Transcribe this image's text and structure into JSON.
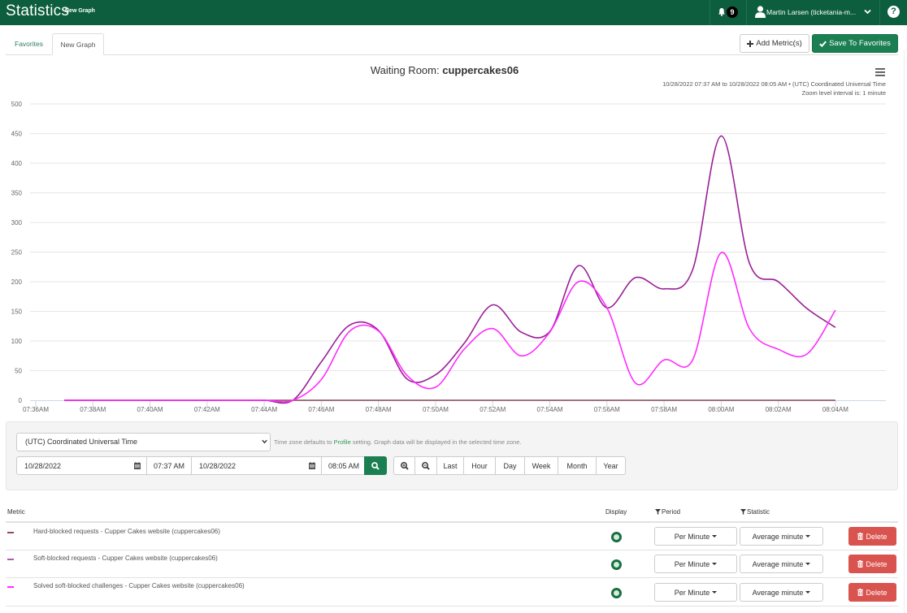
{
  "header": {
    "app_title": "Statistics",
    "subtitle": "New Graph",
    "notifications_count": "9",
    "user_name": "Martin Larsen (ticketania-m...",
    "help_label": "?"
  },
  "tabs": [
    {
      "label": "Favorites",
      "active": false
    },
    {
      "label": "New Graph",
      "active": true
    }
  ],
  "toolbar": {
    "add_metric_label": "Add Metric(s)",
    "save_favorites_label": "Save To Favorites"
  },
  "chart_data": {
    "type": "line",
    "smoothing": "spline",
    "title": "Waiting Room: cuppercakes06",
    "title_prefix": "Waiting Room: ",
    "title_name": "cuppercakes06",
    "subtitle_line1": "10/28/2022 07:37 AM to 10/28/2022 08:05 AM • (UTC) Coordinated Universal Time",
    "subtitle_line2": "Zoom level interval is: 1 minute",
    "xlabel": "",
    "ylabel": "",
    "grid": true,
    "legend": "none (shown in metric table below)",
    "ylim": [
      0,
      500
    ],
    "y_ticks": [
      0,
      50,
      100,
      150,
      200,
      250,
      300,
      350,
      400,
      450,
      500
    ],
    "x_tick_labels": [
      "07:36AM",
      "07:38AM",
      "07:40AM",
      "07:42AM",
      "07:44AM",
      "07:46AM",
      "07:48AM",
      "07:50AM",
      "07:52AM",
      "07:54AM",
      "07:56AM",
      "07:58AM",
      "08:00AM",
      "08:02AM",
      "08:04AM"
    ],
    "x": [
      "07:37",
      "07:38",
      "07:39",
      "07:40",
      "07:41",
      "07:42",
      "07:43",
      "07:44",
      "07:45",
      "07:46",
      "07:47",
      "07:48",
      "07:49",
      "07:50",
      "07:51",
      "07:52",
      "07:53",
      "07:54",
      "07:55",
      "07:56",
      "07:57",
      "07:58",
      "07:59",
      "08:00",
      "08:01",
      "08:02",
      "08:03",
      "08:04"
    ],
    "series": [
      {
        "name": "Hard-blocked requests - Cupper Cakes website (cuppercakes06)",
        "color": "#8e4a58",
        "values": [
          0,
          0,
          0,
          0,
          0,
          0,
          0,
          0,
          0,
          0,
          0,
          0,
          0,
          0,
          0,
          0,
          0,
          0,
          0,
          0,
          0,
          0,
          0,
          0,
          0,
          0,
          0,
          0
        ]
      },
      {
        "name": "Soft-blocked requests - Cupper Cakes website (cuppercakes06)",
        "color": "#991f96",
        "values": [
          0,
          0,
          0,
          0,
          0,
          0,
          0,
          0,
          0,
          65,
          127,
          118,
          36,
          43,
          96,
          161,
          115,
          116,
          227,
          156,
          207,
          188,
          220,
          446,
          230,
          200,
          155,
          123
        ]
      },
      {
        "name": "Solved soft-blocked challenges - Cupper Cakes website (cuppercakes06)",
        "color": "#ff2bff",
        "values": [
          0,
          0,
          0,
          0,
          0,
          0,
          0,
          0,
          0,
          35,
          117,
          117,
          42,
          22,
          86,
          121,
          75,
          115,
          200,
          156,
          29,
          68,
          68,
          249,
          120,
          86,
          78,
          152
        ]
      }
    ]
  },
  "controls": {
    "timezone": "(UTC) Coordinated Universal Time",
    "timezone_note_prefix": "Time zone defaults to ",
    "timezone_note_link": "Profile",
    "timezone_note_suffix": " setting. Graph data will be displayed in the selected time zone.",
    "start_date": "10/28/2022",
    "start_time": "07:37 AM",
    "end_date": "10/28/2022",
    "end_time": "08:05 AM",
    "range_buttons": [
      "Last",
      "Hour",
      "Day",
      "Week",
      "Month",
      "Year"
    ]
  },
  "metrics_table": {
    "headers": {
      "metric": "Metric",
      "display": "Display",
      "period": "Period",
      "statistic": "Statistic"
    },
    "rows": [
      {
        "name": "Hard-blocked requests - Cupper Cakes website (cuppercakes06)",
        "color": "#8e4a58",
        "displayed": true,
        "period": "Per Minute",
        "statistic": "Average minute",
        "delete_label": "Delete"
      },
      {
        "name": "Soft-blocked requests - Cupper Cakes website (cuppercakes06)",
        "color": "#b457b3",
        "displayed": true,
        "period": "Per Minute",
        "statistic": "Average minute",
        "delete_label": "Delete"
      },
      {
        "name": "Solved soft-blocked challenges - Cupper Cakes website (cuppercakes06)",
        "color": "#ff2bff",
        "displayed": true,
        "period": "Per Minute",
        "statistic": "Average minute",
        "delete_label": "Delete"
      }
    ]
  }
}
